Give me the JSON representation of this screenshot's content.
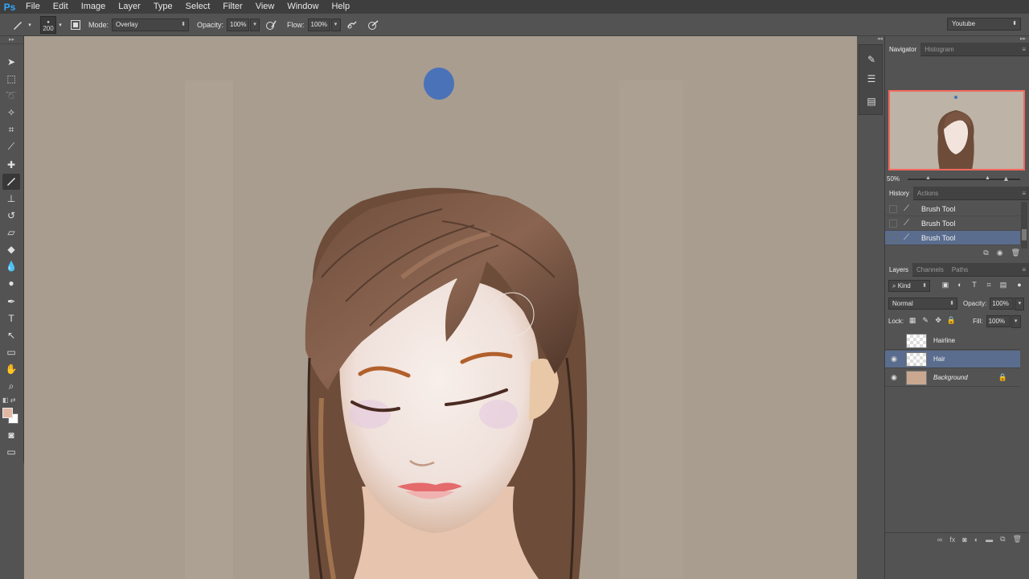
{
  "app": {
    "logo": "Ps"
  },
  "menu": [
    "File",
    "Edit",
    "Image",
    "Layer",
    "Type",
    "Select",
    "Filter",
    "View",
    "Window",
    "Help"
  ],
  "options": {
    "brush_size": "200",
    "mode_label": "Mode:",
    "mode_value": "Overlay",
    "opacity_label": "Opacity:",
    "opacity_value": "100%",
    "flow_label": "Flow:",
    "flow_value": "100%",
    "workspace": "Youtube"
  },
  "tools": {
    "icons": [
      "move-icon",
      "marquee-icon",
      "lasso-icon",
      "quick-select-icon",
      "crop-icon",
      "eyedropper-icon",
      "healing-brush-icon",
      "brush-icon",
      "clone-stamp-icon",
      "history-brush-icon",
      "eraser-icon",
      "gradient-icon",
      "blur-icon",
      "dodge-icon",
      "pen-icon",
      "type-icon",
      "path-select-icon",
      "rectangle-icon",
      "hand-icon",
      "zoom-icon"
    ],
    "foreground_color": "#e2b8a4",
    "background_color": "#ffffff"
  },
  "navigator": {
    "tabs": [
      "Navigator",
      "Histogram"
    ],
    "zoom": "50%"
  },
  "history": {
    "tabs": [
      "History",
      "Actions"
    ],
    "items": [
      {
        "label": "Brush Tool"
      },
      {
        "label": "Brush Tool"
      },
      {
        "label": "Brush Tool"
      }
    ]
  },
  "layers": {
    "tabs": [
      "Layers",
      "Channels",
      "Paths"
    ],
    "filter_kind": "Kind",
    "blend_mode": "Normal",
    "opacity_label": "Opacity:",
    "opacity_value": "100%",
    "lock_label": "Lock:",
    "fill_label": "Fill:",
    "fill_value": "100%",
    "items": [
      {
        "name": "Hairline"
      },
      {
        "name": "Hair"
      },
      {
        "name": "Background"
      }
    ]
  },
  "colors": {
    "canvas_bg": "#a99d8f",
    "selection": "#5a6d8e",
    "navigator_frame": "#f2685c",
    "blue_dot": "#4a72b8"
  }
}
